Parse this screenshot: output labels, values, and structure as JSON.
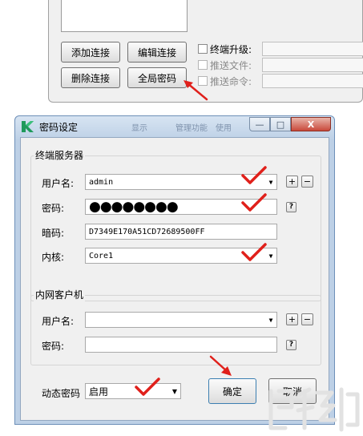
{
  "background_window": {
    "buttons": {
      "add_connection": "添加连接",
      "edit_connection": "编辑连接",
      "delete_connection": "删除连接",
      "global_password": "全局密码"
    },
    "options": {
      "terminal_upgrade": "终端升级:",
      "push_file": "推送文件:",
      "push_command": "推送命令:"
    }
  },
  "dialog": {
    "title": "密码设定",
    "faint_title_a": "显示",
    "faint_title_b": "管理功能",
    "faint_title_c": "使用",
    "window_controls": {
      "minimize": "—",
      "maximize": "□",
      "close": "X"
    },
    "terminal_server": {
      "group_title": "终端服务器",
      "username_label": "用户名:",
      "username_value": "admin",
      "password_label": "密码:",
      "password_mask": "●●●●●●●●",
      "cipher_label": "暗码:",
      "cipher_value": "D7349E170A51CD72689500FF",
      "kernel_label": "内核:",
      "kernel_value": "Core1",
      "add_glyph": "+",
      "remove_glyph": "−",
      "help_glyph": "?"
    },
    "intranet_client": {
      "group_title": "内网客户机",
      "username_label": "用户名:",
      "username_value": "",
      "password_label": "密码:",
      "password_value": "",
      "add_glyph": "+",
      "remove_glyph": "−",
      "help_glyph": "?"
    },
    "dynamic_password_label": "动态密码",
    "dynamic_password_value": "启用",
    "ok_button": "确定",
    "cancel_button": "取消"
  },
  "colors": {
    "annotation_red": "#e0201b",
    "dialog_frame": "#bdd0e6",
    "client_bg": "#f0f0f0"
  }
}
